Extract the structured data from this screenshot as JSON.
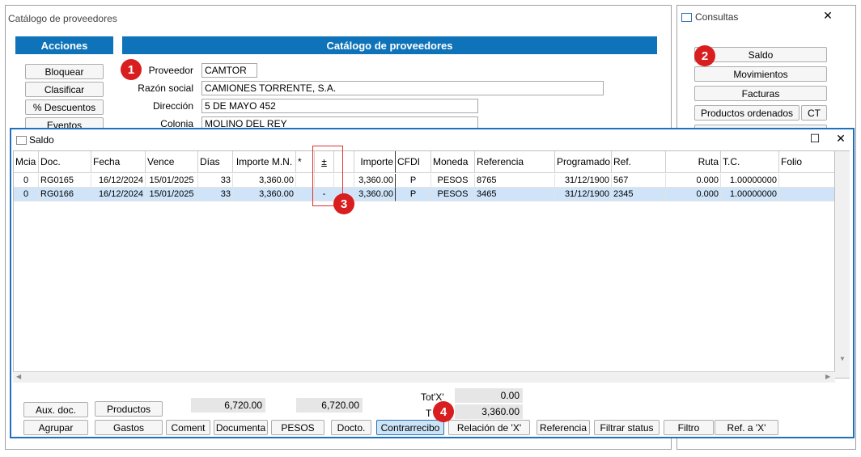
{
  "back_window": {
    "title": "Catálogo de proveedores",
    "acciones_header": "Acciones",
    "catalogo_header": "Catálogo de proveedores",
    "actions": [
      "Bloquear",
      "Clasificar",
      "% Descuentos",
      "Eventos"
    ],
    "fields": {
      "proveedor_label": "Proveedor",
      "proveedor_value": "CAMTOR",
      "razon_label": "Razón social",
      "razon_value": "CAMIONES TORRENTE, S.A.",
      "direccion_label": "Dirección",
      "direccion_value": "5 DE MAYO 452",
      "colonia_label": "Colonia",
      "colonia_value": "MOLINO DEL REY"
    }
  },
  "consultas": {
    "title": "Consultas",
    "close": "✕",
    "buttons": [
      "Saldo",
      "Movimientos",
      "Facturas",
      "Productos ordenados"
    ],
    "ct": "CT"
  },
  "badges": [
    "1",
    "2",
    "3",
    "4"
  ],
  "saldo": {
    "title": "Saldo",
    "maximize": "☐",
    "close": "✕",
    "columns": [
      "Mcia",
      "Doc.",
      "Fecha",
      "Vence",
      "Días",
      "Importe M.N.",
      "*",
      "±",
      "",
      "Importe",
      "CFDI",
      "Moneda",
      "Referencia",
      "Programado",
      "Ref.",
      "Ruta",
      "T.C.",
      "Folio"
    ],
    "rows": [
      [
        "0",
        "RG0165",
        "16/12/2024",
        "15/01/2025",
        "33",
        "3,360.00",
        "",
        "",
        "",
        "3,360.00",
        "P",
        "PESOS",
        "8765",
        "31/12/1900",
        "567",
        "0.000",
        "1.00000000",
        ""
      ],
      [
        "0",
        "RG0166",
        "16/12/2024",
        "15/01/2025",
        "33",
        "3,360.00",
        "",
        "-",
        "",
        "3,360.00",
        "P",
        "PESOS",
        "3465",
        "31/12/1900",
        "2345",
        "0.000",
        "1.00000000",
        ""
      ]
    ],
    "totals": {
      "sum_mn": "6,720.00",
      "sum_importe": "6,720.00",
      "totx_label": "Tot'X'",
      "totx_value": "0.00",
      "t_label": "T",
      "t_value": "3,360.00"
    },
    "buttons_row1": [
      "Aux. doc.",
      "Productos"
    ],
    "buttons_row2": [
      "Agrupar",
      "Gastos",
      "Coment",
      "Documenta",
      "PESOS",
      "Docto.",
      "Contrarrecibo",
      "Relación de 'X'",
      "Referencia",
      "Filtrar status",
      "Filtro",
      "Ref. a 'X'"
    ]
  },
  "colors": {
    "accent": "#0e73b8",
    "badge": "#d81e1e",
    "highlight_box": "#e03030",
    "selected_row": "#cfe4f8"
  }
}
